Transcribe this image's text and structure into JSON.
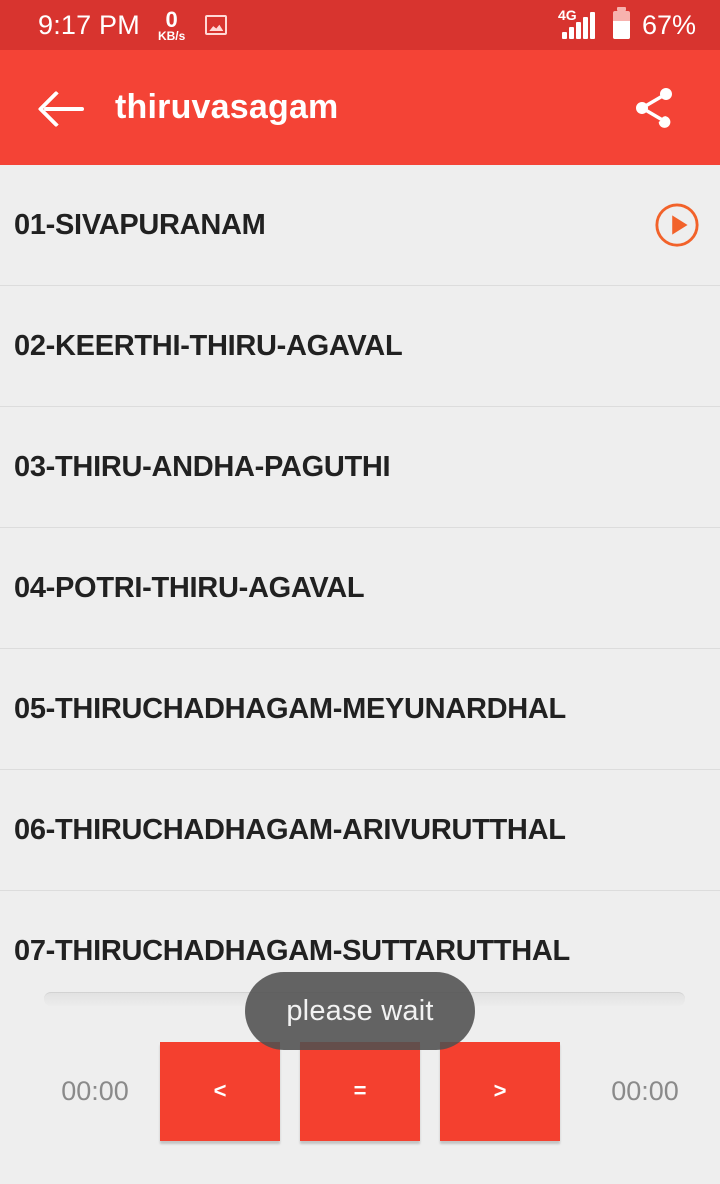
{
  "status_bar": {
    "time": "9:17 PM",
    "net_speed_value": "0",
    "net_speed_unit": "KB/s",
    "photo_icon": "photo-icon",
    "network_type": "4G",
    "signal_icon": "signal-bars-icon",
    "battery_icon": "battery-icon",
    "battery_percent": "67%"
  },
  "app_bar": {
    "back_icon": "back-arrow-icon",
    "title": "thiruvasagam",
    "share_icon": "share-icon"
  },
  "list": {
    "items": [
      {
        "label": "01-SIVAPURANAM",
        "has_play": true,
        "play_icon": "play-circle-icon"
      },
      {
        "label": "02-KEERTHI-THIRU-AGAVAL",
        "has_play": false
      },
      {
        "label": "03-THIRU-ANDHA-PAGUTHI",
        "has_play": false
      },
      {
        "label": "04-POTRI-THIRU-AGAVAL",
        "has_play": false
      },
      {
        "label": "05-THIRUCHADHAGAM-MEYUNARDHAL",
        "has_play": false
      },
      {
        "label": "06-THIRUCHADHAGAM-ARIVURUTTHAL",
        "has_play": false
      },
      {
        "label": "07-THIRUCHADHAGAM-SUTTARUTTHAL",
        "has_play": false
      }
    ]
  },
  "player": {
    "seekbar_name": "seek-bar",
    "elapsed_time": "00:00",
    "total_time": "00:00",
    "prev_label": "<",
    "pause_label": "=",
    "next_label": ">"
  },
  "toast": {
    "message": "please wait"
  },
  "colors": {
    "status_bar": "#d8342f",
    "app_bar": "#f44336",
    "button_red": "#f4402f",
    "play_orange": "#f2622a",
    "background": "#eeeeee",
    "toast_bg": "rgba(80,80,80,.88)"
  }
}
